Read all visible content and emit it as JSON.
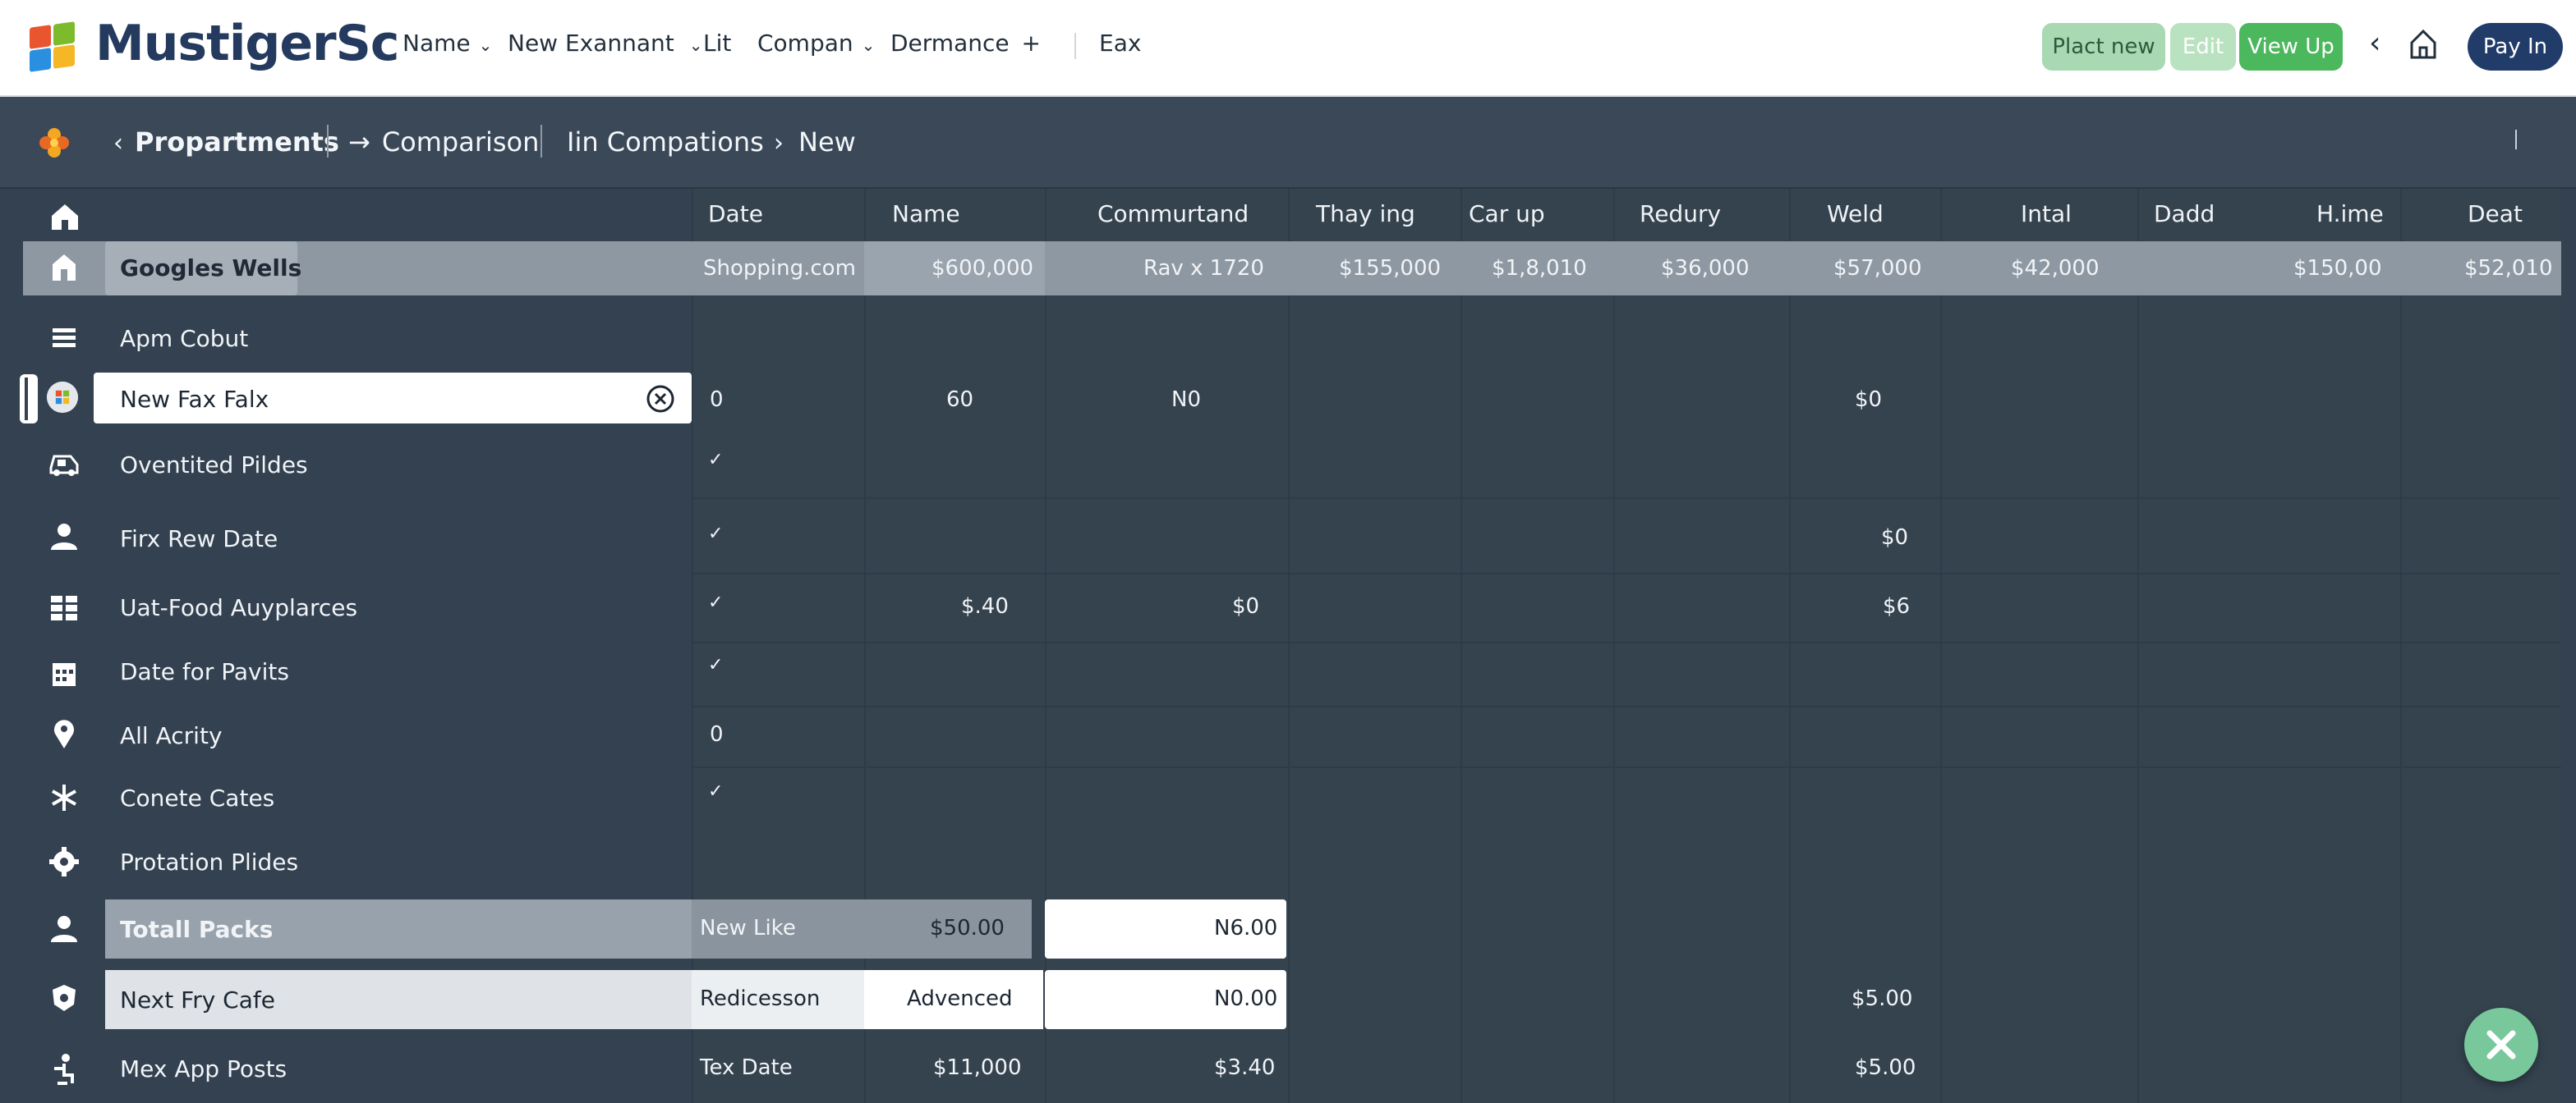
{
  "brand": {
    "name": "MustigerSc",
    "logo": "windows-tile-logo"
  },
  "topnav": [
    {
      "label": "Name",
      "dropdown": true
    },
    {
      "label": "New Exannant",
      "dropdown": true
    },
    {
      "label": "Lit",
      "dropdown": false
    },
    {
      "label": "Compan",
      "dropdown": true
    },
    {
      "label": "Dermance",
      "dropdown": false,
      "suffix": "+"
    },
    {
      "label": "Eax",
      "dropdown": false
    }
  ],
  "actions": {
    "place_new": "Plact new",
    "edit": "Edit",
    "view_up": "View Up",
    "pay_in": "Pay In",
    "back_icon": "chevron-left-icon",
    "home_icon": "home-icon"
  },
  "breadcrumb": {
    "icon": "flower-icon",
    "items": [
      "Propartments",
      "Comparison",
      "Iin Compations",
      "New"
    ]
  },
  "table": {
    "columns": [
      "Date",
      "Name",
      "Commurtand",
      "Thay ing",
      "Car up",
      "Redury",
      "Weld",
      "Intal",
      "Dadd",
      "H.ime",
      "Deat"
    ],
    "rows": [
      {
        "label": "Googles Wells",
        "icon": "store-icon",
        "highlight": "band",
        "cells": {
          "date": "Shopping.com",
          "name": "$600,000",
          "commurtand": "Rav x 1720",
          "thay": "$155,000",
          "car": "$1,8,010",
          "redury": "$36,000",
          "weld": "$57,000",
          "intal": "$42,000",
          "hime": "$150,00",
          "deat": "$52,010"
        }
      },
      {
        "label": "Apm Cobut",
        "icon": "list-icon",
        "cells": {}
      },
      {
        "label": "New Fax Falx",
        "icon": "app-badge-icon",
        "selected": true,
        "clear_icon": "clear-circle-icon",
        "cells": {
          "date": "0",
          "name": "60",
          "commurtand": "N0",
          "weld": "$0"
        }
      },
      {
        "label": "Oventited Pildes",
        "icon": "car-icon",
        "cells": {
          "date": "✓"
        }
      },
      {
        "label": "Firx Rew Date",
        "icon": "person-icon",
        "cells": {
          "date": "✓",
          "weld": "$0"
        }
      },
      {
        "label": "Uat-Food Auyplarces",
        "icon": "grid-icon",
        "cells": {
          "date": "✓",
          "name": "$.40",
          "commurtand": "$0",
          "weld": "$6"
        }
      },
      {
        "label": "Date for Pavits",
        "icon": "calendar-icon",
        "cells": {
          "date": "✓"
        }
      },
      {
        "label": "All Acrity",
        "icon": "pin-icon",
        "cells": {
          "date": "0"
        }
      },
      {
        "label": "Conete Cates",
        "icon": "snowflake-icon",
        "cells": {
          "date": "✓"
        }
      },
      {
        "label": "Protation Plides",
        "icon": "gear-icon",
        "cells": {}
      },
      {
        "label": "Totall Packs",
        "icon": "user-icon",
        "highlight": "gray",
        "cells": {
          "date": "New Like",
          "name": "$50.00",
          "commurtand": "N6.00"
        }
      },
      {
        "label": "Next Fry Cafe",
        "icon": "shield-icon",
        "highlight": "light",
        "cells": {
          "date": "Redicesson",
          "name": "Advenced",
          "commurtand": "N0.00",
          "weld": "$5.00"
        }
      },
      {
        "label": "Mex App Posts",
        "icon": "accessibility-icon",
        "cells": {
          "date": "Tex Date",
          "name": "$11,000",
          "commurtand": "$3.40",
          "weld": "$5.00"
        }
      }
    ]
  },
  "fab": {
    "icon": "close-icon"
  }
}
